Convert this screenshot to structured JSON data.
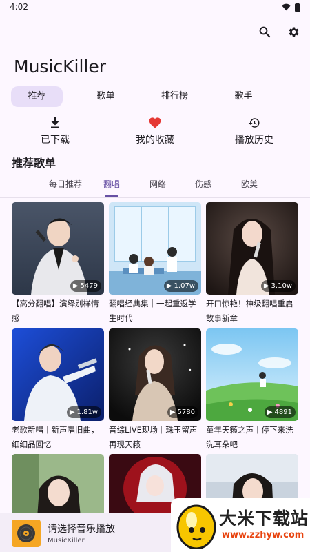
{
  "status": {
    "time": "4:02"
  },
  "app": {
    "title": "MusicKiller"
  },
  "tabs": [
    {
      "label": "推荐",
      "active": true
    },
    {
      "label": "歌单",
      "active": false
    },
    {
      "label": "排行榜",
      "active": false
    },
    {
      "label": "歌手",
      "active": false
    }
  ],
  "quick_actions": [
    {
      "label": "已下载",
      "icon": "download-icon"
    },
    {
      "label": "我的收藏",
      "icon": "heart-icon"
    },
    {
      "label": "播放历史",
      "icon": "history-icon"
    }
  ],
  "section": {
    "title": "推荐歌单"
  },
  "subtabs": [
    {
      "label": "每日推荐"
    },
    {
      "label": "翻唱",
      "active": true
    },
    {
      "label": "网络"
    },
    {
      "label": "伤感"
    },
    {
      "label": "欧美"
    }
  ],
  "playlists": [
    {
      "title": "【高分翻唱】演绎别样情感",
      "plays": "5479"
    },
    {
      "title": "翻唱经典集｜一起重返学生时代",
      "plays": "1.07w"
    },
    {
      "title": "开口惊艳！神级翻唱重启故事新章",
      "plays": "3.10w"
    },
    {
      "title": "老歌新唱｜新声唱旧曲，细细品回忆",
      "plays": "1.81w"
    },
    {
      "title": "音综LIVE现场｜珠玉留声再现天籁",
      "plays": "5780"
    },
    {
      "title": "童年天籁之声｜停下来洗洗耳朵吧",
      "plays": "4891"
    },
    {
      "title": "",
      "plays": ""
    },
    {
      "title": "",
      "plays": ""
    },
    {
      "title": "",
      "plays": ""
    }
  ],
  "player": {
    "title": "请选择音乐播放",
    "subtitle": "MusicKiller"
  },
  "watermark": {
    "name": "大米下载站",
    "url": "www.zzhyw.com"
  },
  "colors": {
    "accent": "#6750a4",
    "tab_active_bg": "#e8def8",
    "heart": "#e53935",
    "background": "#fdf7ff"
  }
}
